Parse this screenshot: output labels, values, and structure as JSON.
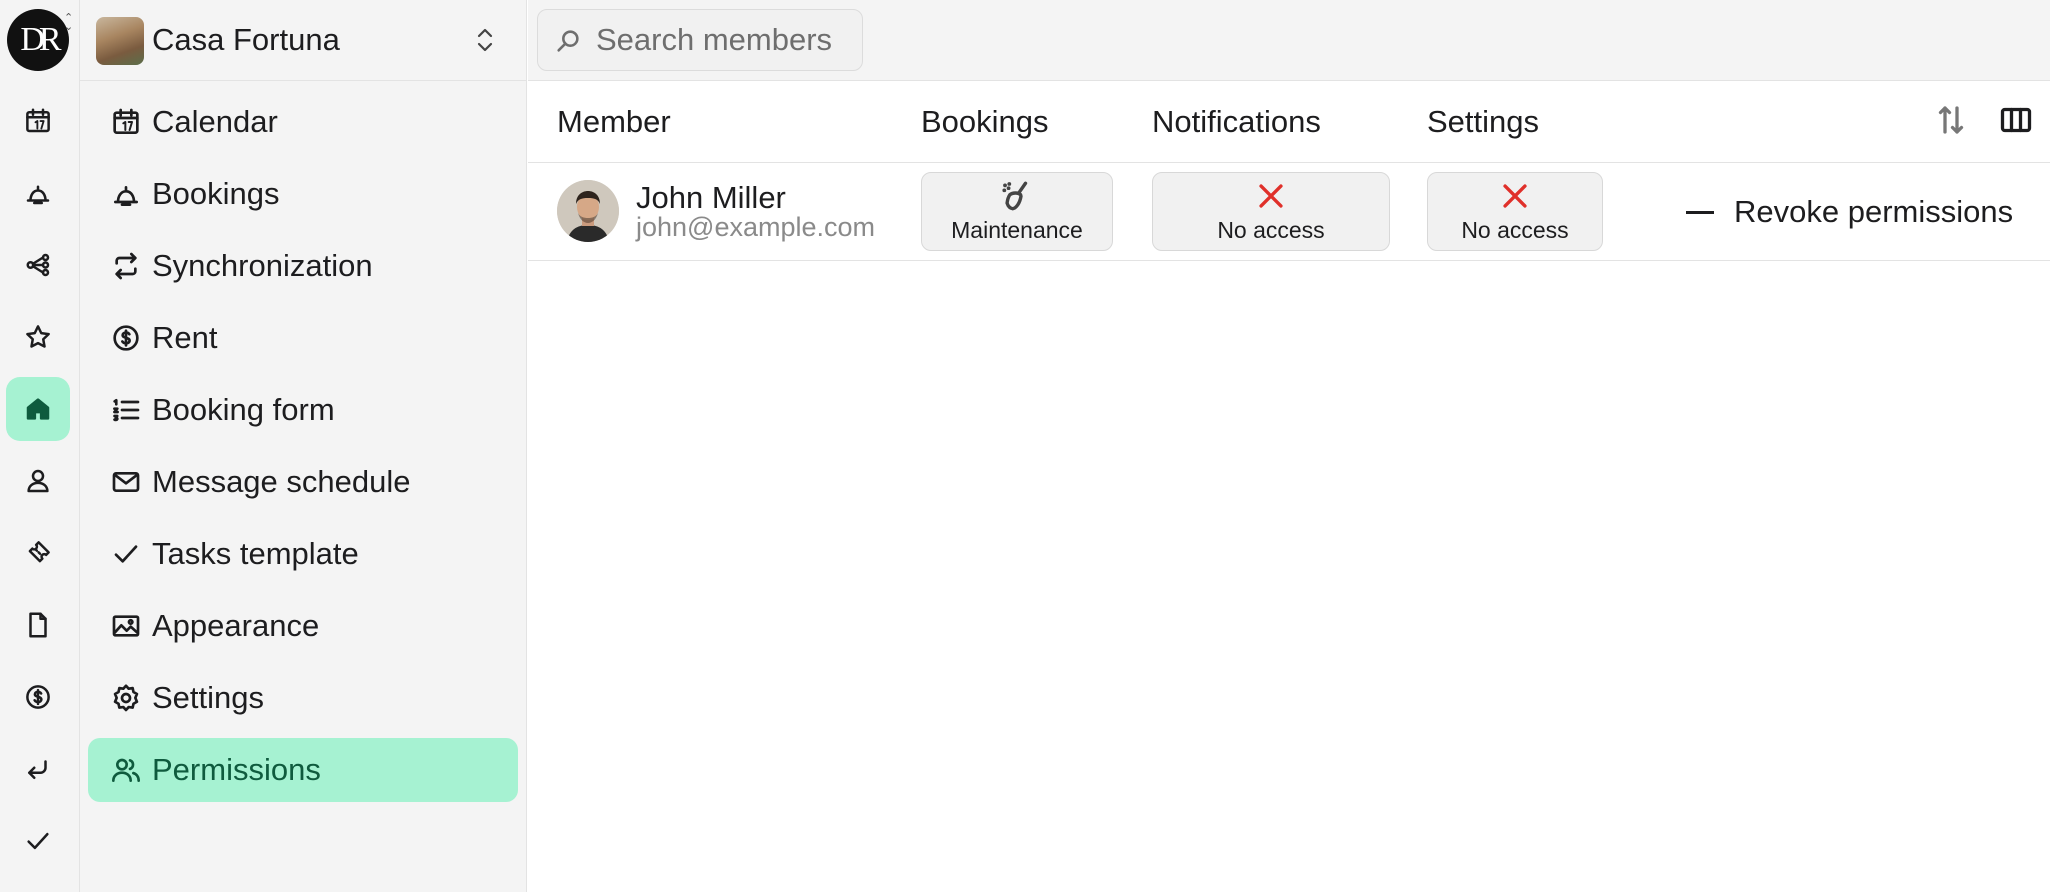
{
  "brand": {
    "initials": "DR"
  },
  "workspace": {
    "name": "Casa Fortuna"
  },
  "rail": {
    "items": [
      {
        "icon": "calendar-icon",
        "active": false
      },
      {
        "icon": "bell-icon",
        "active": false
      },
      {
        "icon": "channels-icon",
        "active": false
      },
      {
        "icon": "star-icon",
        "active": false
      },
      {
        "icon": "home-icon",
        "active": true
      },
      {
        "icon": "user-icon",
        "active": false
      },
      {
        "icon": "ticket-icon",
        "active": false
      },
      {
        "icon": "file-icon",
        "active": false
      },
      {
        "icon": "dollar-icon",
        "active": false
      },
      {
        "icon": "return-icon",
        "active": false
      },
      {
        "icon": "check-icon",
        "active": false
      }
    ]
  },
  "nav": {
    "items": [
      {
        "label": "Calendar",
        "icon": "calendar-icon",
        "active": false
      },
      {
        "label": "Bookings",
        "icon": "bell-icon",
        "active": false
      },
      {
        "label": "Synchronization",
        "icon": "sync-icon",
        "active": false
      },
      {
        "label": "Rent",
        "icon": "dollar-icon",
        "active": false
      },
      {
        "label": "Booking form",
        "icon": "list-icon",
        "active": false
      },
      {
        "label": "Message schedule",
        "icon": "mail-icon",
        "active": false
      },
      {
        "label": "Tasks template",
        "icon": "check-icon",
        "active": false
      },
      {
        "label": "Appearance",
        "icon": "image-icon",
        "active": false
      },
      {
        "label": "Settings",
        "icon": "gear-icon",
        "active": false
      },
      {
        "label": "Permissions",
        "icon": "users-icon",
        "active": true
      }
    ]
  },
  "search": {
    "placeholder": "Search members",
    "value": ""
  },
  "table": {
    "columns": [
      "Member",
      "Bookings",
      "Notifications",
      "Settings"
    ],
    "rows": [
      {
        "name": "John Miller",
        "email": "john@example.com",
        "bookings": {
          "label": "Maintenance",
          "icon": "broom-icon"
        },
        "notifications": {
          "label": "No access",
          "icon": "x-icon"
        },
        "settings": {
          "label": "No access",
          "icon": "x-icon"
        },
        "action": "Revoke permissions"
      }
    ]
  },
  "colors": {
    "accent": "#a6f2d2",
    "deny": "#e0302a",
    "sidebar_bg": "#f4f4f4"
  }
}
